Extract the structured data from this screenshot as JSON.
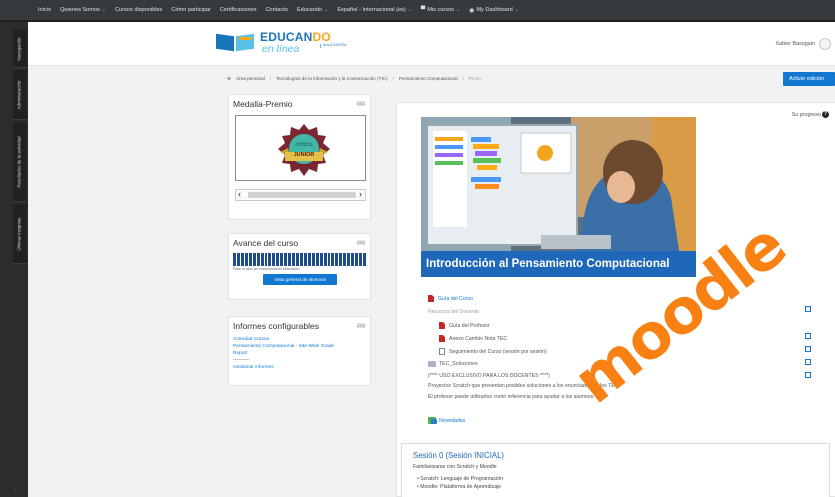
{
  "topnav": {
    "items": [
      {
        "label": "Inicio",
        "caret": false
      },
      {
        "label": "Quienes Somos",
        "caret": true
      },
      {
        "label": "Cursos disponibles",
        "caret": false
      },
      {
        "label": "Cómo participar",
        "caret": false
      },
      {
        "label": "Certificaciones",
        "caret": false
      },
      {
        "label": "Contacto",
        "caret": false
      },
      {
        "label": "Educando",
        "caret": true
      },
      {
        "label": "Español - Internacional (es)",
        "caret": true
      },
      {
        "label": "Mis cursos",
        "caret": true,
        "icon": "mortarboard-icon"
      },
      {
        "label": "My Dashboard",
        "caret": true,
        "icon": "dashboard-icon"
      }
    ]
  },
  "drawer": {
    "tabs": [
      "Navegación",
      "Administración",
      "Resultados de la actividad",
      "Últimas insignias"
    ]
  },
  "header": {
    "brand_main": "EDUCAN",
    "brand_accent": "DO",
    "brand_tag": "en línea",
    "brand_mini": "AULA DIGITAL",
    "user_name": "Xabier Basogain"
  },
  "breadcrumb": [
    "Área personal",
    "Tecnologías de la Información y la Comunicación (TIC)",
    "Pensamiento Computacional",
    "PCSA"
  ],
  "edit_button": "Activar edición",
  "blocks": {
    "medal": {
      "title": "Medalla-Premio",
      "medal_text": "JUNIOR",
      "medal_small": "PENSAMIENTO COMPUTACIONAL"
    },
    "progress": {
      "title": "Avance del curso",
      "note": "Pasar el ratón por encima para ver información",
      "button": "Vista general de alumnos",
      "fraction_complete": 1.0
    },
    "reports": {
      "title": "Informes configurables",
      "links": [
        "Actividad Cursos",
        "Pensamiento Computacional - Site-Wide Grade",
        "Report"
      ],
      "separator": "----------",
      "manage": "Gestionar informes"
    }
  },
  "main": {
    "progress_label": "Su progreso",
    "banner_title": "Introducción al Pensamiento Computacional",
    "items": [
      {
        "label": "Guía del Curso",
        "type": "pdf",
        "style": "link"
      },
      {
        "label": "Recursos del Docente",
        "type": "none",
        "style": "muted"
      },
      {
        "label": "Guía del Profesor",
        "type": "pdf",
        "style": "indent"
      },
      {
        "label": "Anexo Cambio Nota TEC",
        "type": "pdf",
        "style": "indent"
      },
      {
        "label": "Seguimiento del Curso (sesión por sesión)",
        "type": "page",
        "style": "indent"
      },
      {
        "label": "TEC_Soluciones",
        "type": "folder",
        "style": "plain"
      },
      {
        "label": "(**** USO EXCLUSIVO PARA LOS DOCENTES ****)",
        "type": "none",
        "style": "plain"
      },
      {
        "label": "Proyectos Scratch que presentan posibles soluciones a los enunciados de los TEC.",
        "type": "none",
        "style": "plain"
      },
      {
        "label": "El profesor puede utilizarlos como referencia para ayudar a los alumnos.",
        "type": "none",
        "style": "plain"
      },
      {
        "label": "Novedades",
        "type": "forum",
        "style": "link"
      }
    ],
    "section0": {
      "title": "Sesión 0 (Sesión INICIAL)",
      "subtitle": "Familiarizarse con Scratch y Moodle",
      "bullets": [
        "• Scratch: Lenguaje de Programación",
        "• Moodle: Plataforma de Aprendizaje"
      ]
    },
    "watermark": "moodle"
  },
  "colors": {
    "nav_bg": "#373a3c",
    "accent_blue": "#1177d1",
    "banner_blue": "#1f67b8",
    "moodle_orange": "#f98012"
  }
}
